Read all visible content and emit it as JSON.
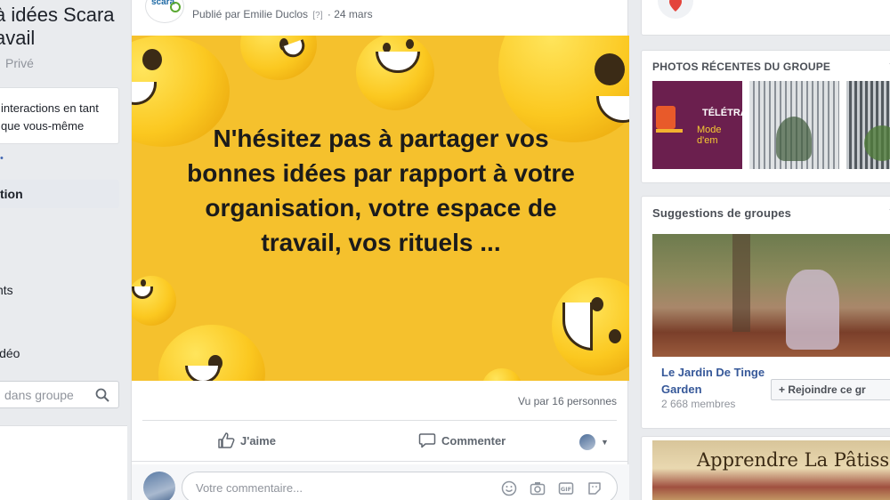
{
  "group": {
    "title_line1": "à idées Scara",
    "title_line2": "avail",
    "privacy": "Privé"
  },
  "left_nav": {
    "info_text_line1": "interactions en tant",
    "info_text_line2": "que vous-même",
    "active_item": "tion",
    "item_events": "nts",
    "item_video": "idéo",
    "search_placeholder": "dans groupe"
  },
  "post": {
    "logo_text": "scara",
    "author_label": "Publié par Emilie Duclos",
    "help_mark": "[?]",
    "date": "24 mars",
    "image_text": "N'hésitez pas à partager vos bonnes idées par rapport à votre organisation, votre espace de travail, vos rituels ...",
    "seen_by": "Vu par 16 personnes",
    "like_label": "J'aime",
    "comment_label": "Commenter",
    "comment_placeholder": "Votre commentaire..."
  },
  "right": {
    "photos_title": "PHOTOS RÉCENTES DU GROUPE",
    "photo1_caption_line1": "TÉLÉTRAV",
    "photo1_caption_line2": "Mode d'em",
    "suggestions_title": "Suggestions de groupes",
    "suggestion": {
      "name": "Le Jardin De Tinge Garden",
      "members": "2 668 membres",
      "join_label": "+ Rejoindre ce gr"
    },
    "next_card_text": "Apprendre La Pâtisseri"
  },
  "colors": {
    "banner_yellow": "#f5c12d",
    "link_blue": "#365899",
    "photo_purple": "#6b1f4e"
  }
}
